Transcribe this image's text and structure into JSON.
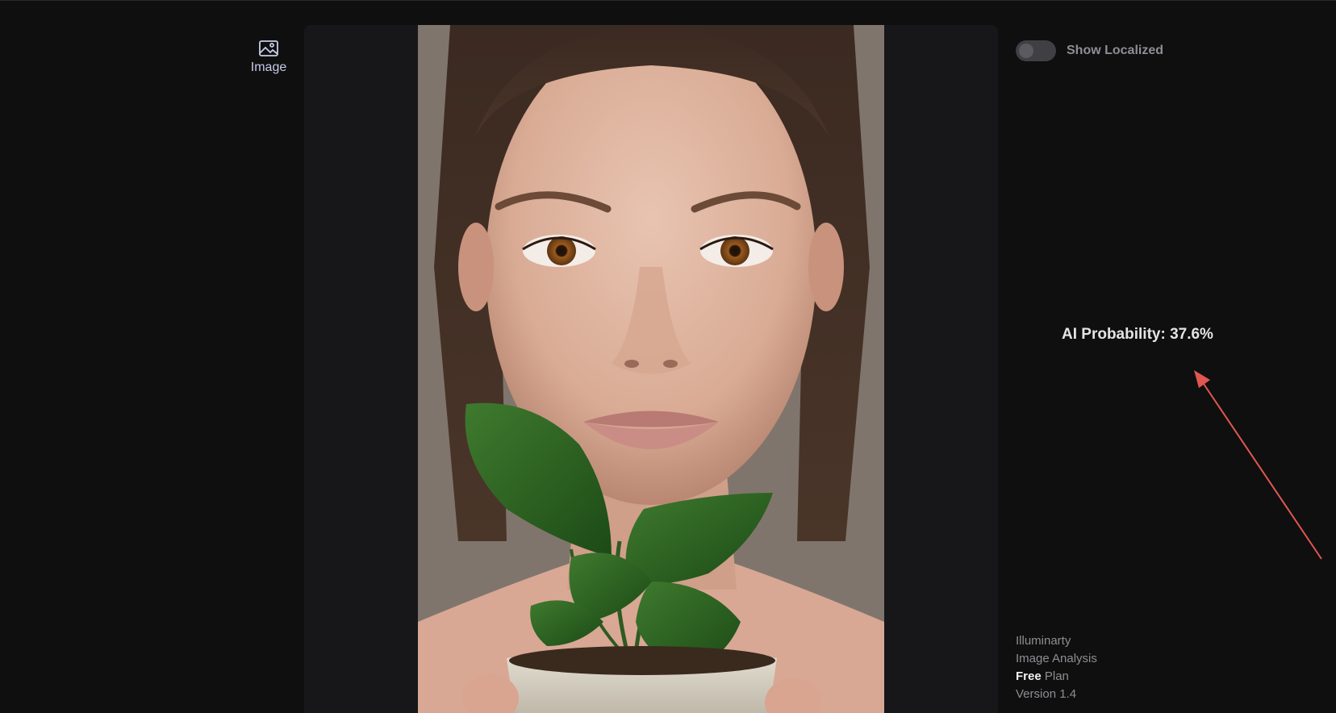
{
  "nav": {
    "items": [
      {
        "label": "Image",
        "icon": "image-icon"
      }
    ]
  },
  "toggle": {
    "label": "Show Localized",
    "checked": false
  },
  "result": {
    "text": "AI Probability: 37.6%"
  },
  "footer": {
    "app_name": "Illuminarty",
    "subtitle": "Image Analysis",
    "plan_strong": "Free",
    "plan_suffix": "Plan",
    "version": "Version 1.4"
  },
  "colors": {
    "background": "#0f0f10",
    "panel": "#17171a",
    "annotation_arrow": "#e0574f"
  }
}
